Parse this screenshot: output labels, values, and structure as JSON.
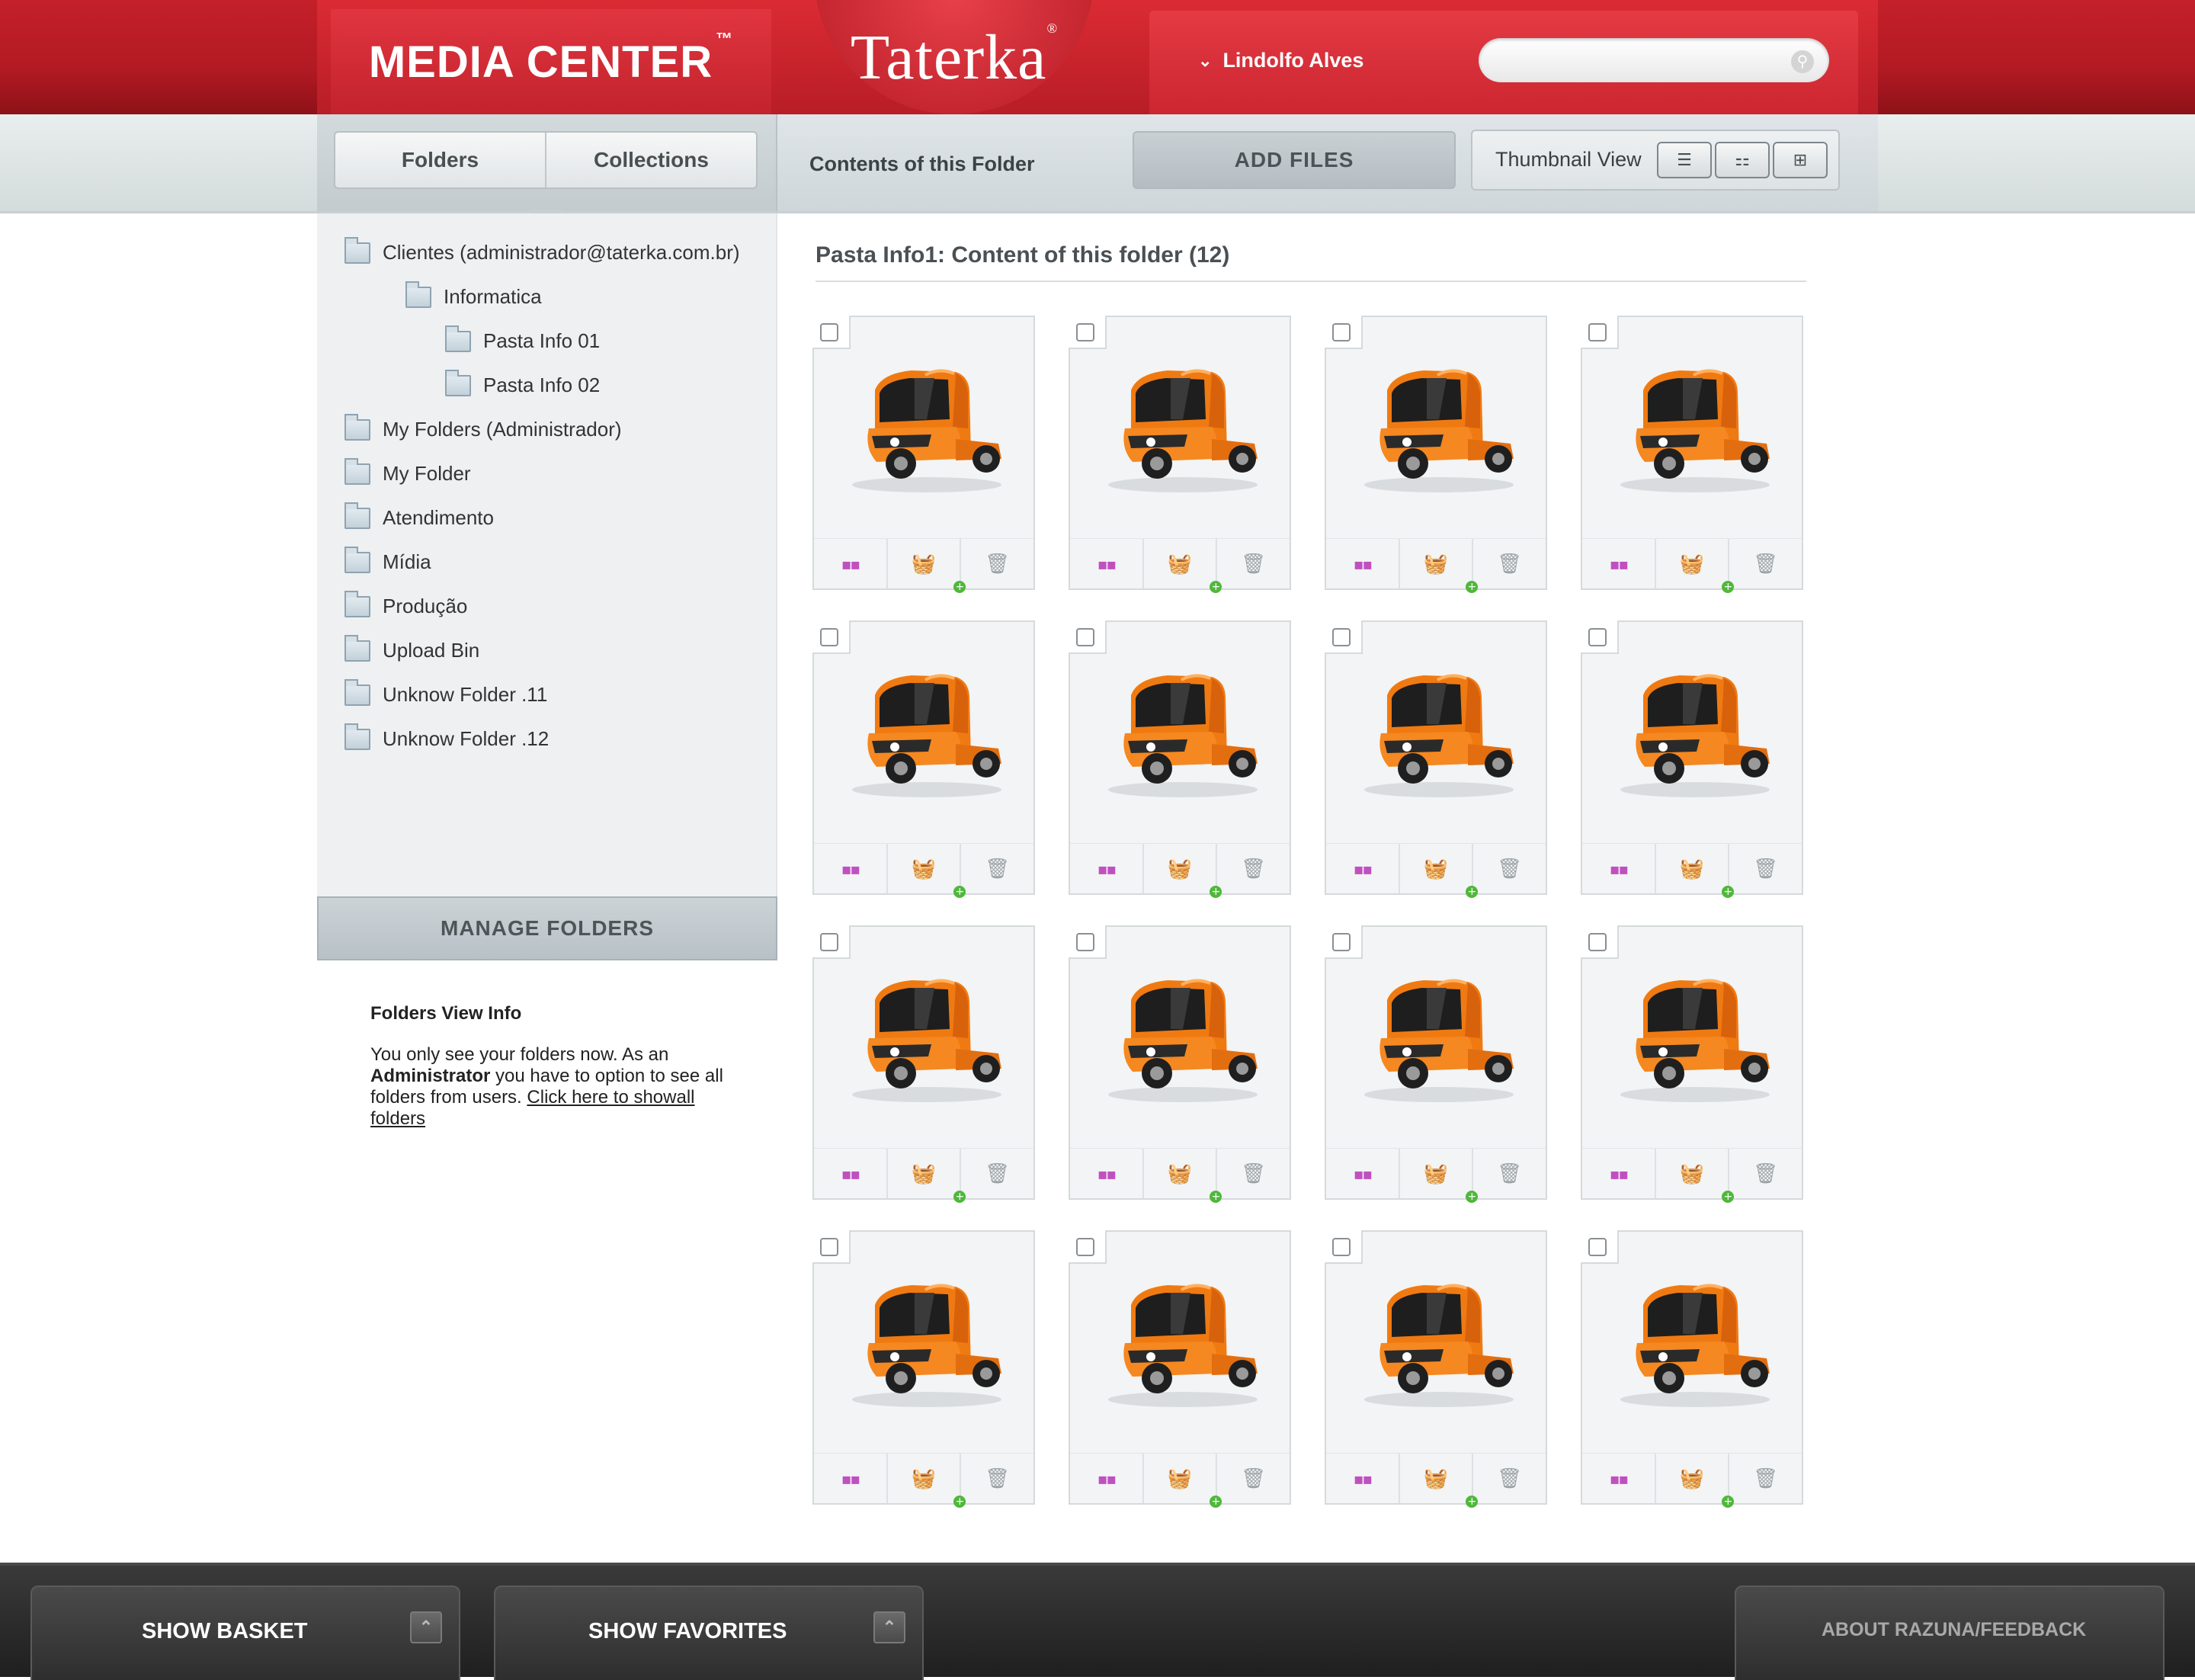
{
  "header": {
    "brand": "MEDIA CENTER",
    "brand_mark": "™",
    "logo": "Taterka",
    "logo_mark": "®",
    "user_name": "Lindolfo Alves",
    "search_placeholder": ""
  },
  "toolbar": {
    "tabs": [
      "Folders",
      "Collections"
    ],
    "title": "Contents of this Folder",
    "add_files": "ADD FILES",
    "view_label": "Thumbnail View",
    "view_modes": [
      "list-view-icon",
      "detail-view-icon",
      "grid-view-icon"
    ]
  },
  "sidebar": {
    "tree": [
      {
        "label": "Clientes (administrador@taterka.com.br)",
        "level": 0
      },
      {
        "label": "Informatica",
        "level": 1
      },
      {
        "label": "Pasta Info 01",
        "level": 2
      },
      {
        "label": "Pasta Info 02",
        "level": 2
      },
      {
        "label": "My Folders (Administrador)",
        "level": 0
      },
      {
        "label": "My Folder",
        "level": 0
      },
      {
        "label": "Atendimento",
        "level": 0
      },
      {
        "label": "Mídia",
        "level": 0
      },
      {
        "label": "Produção",
        "level": 0
      },
      {
        "label": "Upload Bin",
        "level": 0
      },
      {
        "label": "Unknow Folder .11",
        "level": 0
      },
      {
        "label": "Unknow Folder .12",
        "level": 0
      }
    ],
    "manage_button": "MANAGE FOLDERS",
    "info": {
      "title": "Folders View Info",
      "text_1": "You only see your folders now. As an",
      "bold": "Administrator",
      "text_2": " you have to option to see all folders from users. ",
      "link": "Click here to showall folders"
    }
  },
  "content": {
    "title": "Pasta Info1: Content of this folder (12)",
    "item_count": 16,
    "thumbnail_subject": "orange-truck-thumbnail",
    "card_actions": [
      "color-swatch-icon",
      "add-to-basket-icon",
      "trash-icon"
    ]
  },
  "footer": {
    "show_basket": "SHOW BASKET",
    "show_favorites": "SHOW FAVORITES",
    "about": "ABOUT RAZUNA/FEEDBACK"
  },
  "colors": {
    "header_red": "#c4202a",
    "accent_orange": "#f07a12",
    "footer_dark": "#262626"
  }
}
